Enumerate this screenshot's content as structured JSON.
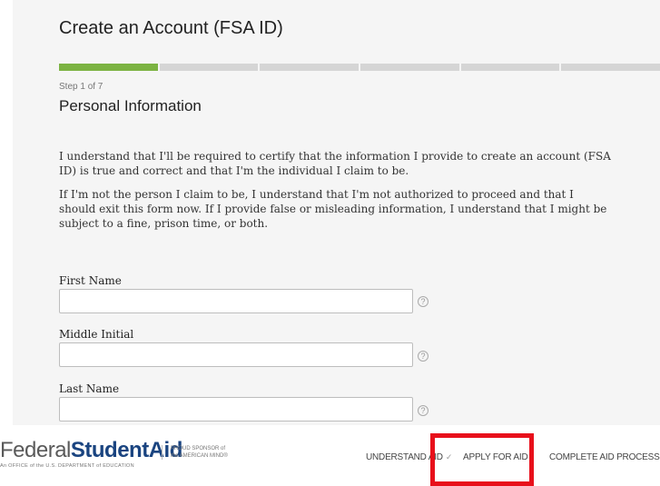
{
  "form": {
    "title": "Create an Account (FSA ID)",
    "progress": {
      "current_step": 1,
      "total_steps": 7
    },
    "step_label": "Step 1 of 7",
    "section_title": "Personal Information",
    "paragraphs": [
      "I understand that I'll be required to certify that the information I provide to create an account (FSA ID) is true and correct and that I'm the individual I claim to be.",
      "If I'm not the person I claim to be, I understand that I'm not authorized to proceed and that I should exit this form now. If I provide false or misleading information, I understand that I might be subject to a fine, prison time, or both."
    ],
    "fields": [
      {
        "label": "First Name",
        "value": ""
      },
      {
        "label": "Middle Initial",
        "value": ""
      },
      {
        "label": "Last Name",
        "value": ""
      }
    ],
    "help_icon": "question-circle-icon"
  },
  "footer": {
    "brand": {
      "part1": "Federal",
      "part2": "Student",
      "part3": "Aid",
      "subline": "An OFFICE of the U.S. DEPARTMENT of EDUCATION"
    },
    "sponsor": {
      "line1": "PROUD SPONSOR of",
      "line2": "the AMERICAN MIND®"
    },
    "nav": [
      {
        "label": "UNDERSTAND AID",
        "chevron": "✓"
      },
      {
        "label": "APPLY FOR AID",
        "chevron": ""
      },
      {
        "label": "COMPLETE AID PROCESS",
        "chevron": "✓"
      }
    ],
    "highlight_color": "#e8101b"
  },
  "colors": {
    "progress_done": "#7cb342",
    "progress_todo": "#d5d5d5",
    "brand_blue": "#1a4480"
  }
}
